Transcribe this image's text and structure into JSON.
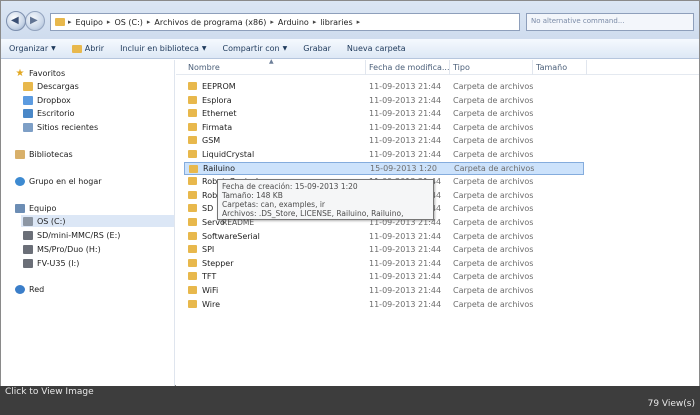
{
  "breadcrumb": [
    "Equipo",
    "OS (C:)",
    "Archivos de programa (x86)",
    "Arduino",
    "libraries"
  ],
  "search": {
    "text": "No alternative command..."
  },
  "toolbar": {
    "organize": "Organizar",
    "open": "Abrir",
    "include": "Incluir en biblioteca",
    "share": "Compartir con",
    "burn": "Grabar",
    "new_folder": "Nueva carpeta"
  },
  "nav": {
    "favorites": "Favoritos",
    "downloads": "Descargas",
    "dropbox": "Dropbox",
    "desktop": "Escritorio",
    "recent": "Sitios recientes",
    "libraries": "Bibliotecas",
    "homegroup": "Grupo en el hogar",
    "computer": "Equipo",
    "os_drive": "OS (C:)",
    "sd_drive": "SD/mini-MMC/RS (E:)",
    "ms_drive": "MS/Pro/Duo (H:)",
    "fv_drive": "FV-U35 (I:)",
    "network": "Red"
  },
  "columns": {
    "name": "Nombre",
    "date": "Fecha de modifica...",
    "type": "Tipo",
    "size": "Tamaño"
  },
  "files": [
    {
      "name": "EEPROM",
      "date": "11-09-2013 21:44",
      "type": "Carpeta de archivos"
    },
    {
      "name": "Esplora",
      "date": "11-09-2013 21:44",
      "type": "Carpeta de archivos"
    },
    {
      "name": "Ethernet",
      "date": "11-09-2013 21:44",
      "type": "Carpeta de archivos"
    },
    {
      "name": "Firmata",
      "date": "11-09-2013 21:44",
      "type": "Carpeta de archivos"
    },
    {
      "name": "GSM",
      "date": "11-09-2013 21:44",
      "type": "Carpeta de archivos"
    },
    {
      "name": "LiquidCrystal",
      "date": "11-09-2013 21:44",
      "type": "Carpeta de archivos"
    },
    {
      "name": "Railuino",
      "date": "15-09-2013 1:20",
      "type": "Carpeta de archivos"
    },
    {
      "name": "Robot_Control",
      "date": "11-09-2013 21:44",
      "type": "Carpeta de archivos"
    },
    {
      "name": "Robot_Motor",
      "date": "11-09-2013 21:44",
      "type": "Carpeta de archivos"
    },
    {
      "name": "SD",
      "date": "11-09-2013 21:44",
      "type": "Carpeta de archivos"
    },
    {
      "name": "Servo",
      "date": "11-09-2013 21:44",
      "type": "Carpeta de archivos"
    },
    {
      "name": "SoftwareSerial",
      "date": "11-09-2013 21:44",
      "type": "Carpeta de archivos"
    },
    {
      "name": "SPI",
      "date": "11-09-2013 21:44",
      "type": "Carpeta de archivos"
    },
    {
      "name": "Stepper",
      "date": "11-09-2013 21:44",
      "type": "Carpeta de archivos"
    },
    {
      "name": "TFT",
      "date": "11-09-2013 21:44",
      "type": "Carpeta de archivos"
    },
    {
      "name": "WiFi",
      "date": "11-09-2013 21:44",
      "type": "Carpeta de archivos"
    },
    {
      "name": "Wire",
      "date": "11-09-2013 21:44",
      "type": "Carpeta de archivos"
    }
  ],
  "tooltip": {
    "created": "Fecha de creación: 15-09-2013 1:20",
    "size": "Tamaño: 148 KB",
    "folders": "Carpetas: can, examples, ir",
    "files": "Archivos: .DS_Store, LICENSE, Railuino, Railuino, README"
  },
  "footer": {
    "click_to_view": "Click to View Image",
    "views": "79 View(s)"
  }
}
